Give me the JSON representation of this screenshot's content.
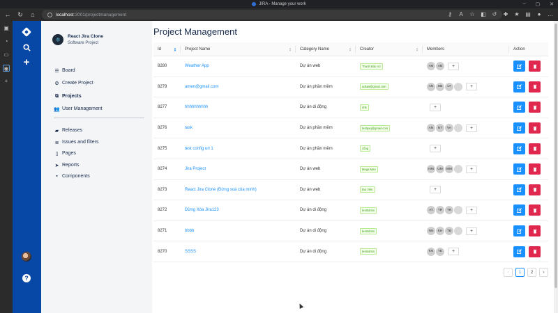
{
  "browser": {
    "window_title": "JIRA - Manage your work",
    "url_host": "localhost",
    "url_path": ":3001/projectmanagement"
  },
  "sidebar": {
    "project_name": "React Jira Clone",
    "project_type": "Software Project",
    "items": [
      {
        "label": "Board",
        "icon": "list-icon"
      },
      {
        "label": "Create Project",
        "icon": "gear-icon"
      },
      {
        "label": "Projects",
        "icon": "sitemap-icon"
      },
      {
        "label": "User Management",
        "icon": "users-icon"
      },
      {
        "label": "Releases",
        "icon": "truck-icon"
      },
      {
        "label": "Issues and filters",
        "icon": "stack-icon"
      },
      {
        "label": "Pages",
        "icon": "file-icon"
      },
      {
        "label": "Reports",
        "icon": "location-arrow-icon"
      },
      {
        "label": "Components",
        "icon": "box-icon"
      }
    ]
  },
  "main": {
    "title": "Project Management",
    "columns": [
      "Id",
      "Project Name",
      "Category Name",
      "Creator",
      "Members",
      "Action"
    ],
    "rows": [
      {
        "id": "8280",
        "name": "Weather App",
        "category": "Dự án web",
        "creator": "Thanh Bảo Vo",
        "members": [
          "AN",
          "AB"
        ]
      },
      {
        "id": "8279",
        "name": "amen@gmail.com",
        "category": "Dự án phần mềm",
        "creator": "adsas@gmail.com",
        "members": [
          "AN",
          "HB",
          "LT",
          ""
        ]
      },
      {
        "id": "8277",
        "name": "hhhhhhhhhh",
        "category": "Dự án di động",
        "creator": "nhk",
        "members": []
      },
      {
        "id": "8276",
        "name": "task",
        "category": "Dự án phần mềm",
        "creator": "testpaq@gmail.com",
        "members": [
          "AN",
          "NT",
          "VA",
          ""
        ]
      },
      {
        "id": "8275",
        "name": "test config url 1",
        "category": "Dự án phần mềm",
        "creator": "cồng",
        "members": []
      },
      {
        "id": "8274",
        "name": "Jira Project",
        "category": "Dự án web",
        "creator": "Mega Man",
        "members": [
          "HM",
          "UM",
          "MM",
          ""
        ]
      },
      {
        "id": "8273",
        "name": "React Jira Clone (Đừng xoá của mình)",
        "category": "Dự án web",
        "creator": "Bui Viên",
        "members": []
      },
      {
        "id": "8272",
        "name": "Đừng Xóa Jira123",
        "category": "Dự án di động",
        "creator": "testhdmin",
        "members": [
          "AT",
          "TR",
          "TR",
          ""
        ]
      },
      {
        "id": "8271",
        "name": "bbbb",
        "category": "Dự án di động",
        "creator": "test4dmin",
        "members": [
          "NN",
          "KH",
          "TB",
          ""
        ]
      },
      {
        "id": "8270",
        "name": "SSSS",
        "category": "Dự án di động",
        "creator": "test4dmin",
        "members": [
          "KN",
          "TE"
        ]
      }
    ],
    "add_label": "+"
  },
  "pagination": {
    "prev": "‹",
    "pages": [
      "1",
      "2"
    ],
    "next": "›",
    "current": "1"
  },
  "colors": {
    "rail": "#0747a6",
    "sidebar": "#f4f5f7",
    "link": "#1890ff",
    "edit": "#1890ff",
    "delete": "#e0284f"
  }
}
